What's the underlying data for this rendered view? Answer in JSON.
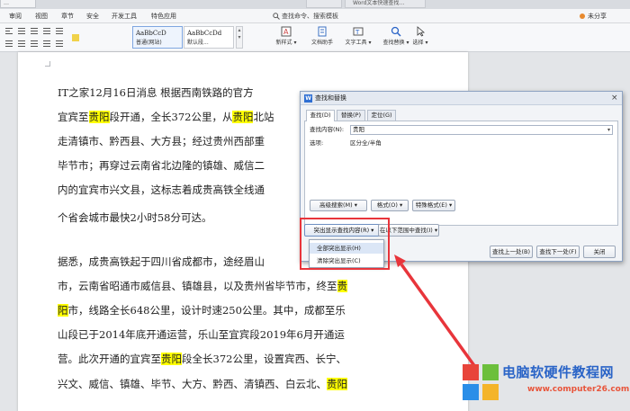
{
  "window": {
    "tab_left_fragment": "…",
    "app_tab_1": "",
    "app_tab_2": "Word文本快速查找…",
    "share": "未分享"
  },
  "menubar": {
    "items": [
      "审阅",
      "视图",
      "章节",
      "安全",
      "开发工具",
      "特色应用"
    ],
    "search": "查找命令、搜索模板"
  },
  "ribbon": {
    "styles": [
      {
        "sample": "AaBbCcD",
        "name": "普通(网站)"
      },
      {
        "sample": "AaBbCcDd",
        "name": "默认段..."
      }
    ],
    "tools": [
      {
        "label": "新样式 ▾",
        "icon": "new-style-icon"
      },
      {
        "label": "文档助手",
        "icon": "doc-helper-icon"
      },
      {
        "label": "文字工具 ▾",
        "icon": "text-tools-icon"
      },
      {
        "label": "查找替换 ▾",
        "icon": "find-replace-icon"
      },
      {
        "label": "选择 ▾",
        "icon": "select-icon"
      }
    ]
  },
  "document": {
    "lines": [
      [
        {
          "t": "IT之家12月16日消息 根据西南铁路的官方"
        }
      ],
      [
        {
          "t": "宜宾至"
        },
        {
          "t": "贵阳",
          "hl": true
        },
        {
          "t": "段开通，全长372公里，从"
        },
        {
          "t": "贵阳",
          "hl": true
        },
        {
          "t": "北站"
        }
      ],
      [
        {
          "t": "走清镇市、黔西县、大方县；经过贵州西部重"
        }
      ],
      [
        {
          "t": "毕节市；再穿过云南省北边隆的镇雄、威信二"
        }
      ],
      [
        {
          "t": "内的宜宾市兴文县，这标志着成贵高铁全线通"
        }
      ],
      [
        {
          "t": "个省会城市最快2小时58分可达。"
        }
      ],
      [
        {
          "t": "据悉，成贵高铁起于四川省成都市，途经眉山"
        }
      ],
      [
        {
          "t": "市，云南省昭通市威信县、镇雄县，以及贵州省毕节市，终至"
        },
        {
          "t": "贵",
          "hl": true
        }
      ],
      [
        {
          "t": "阳",
          "hl": true
        },
        {
          "t": "市，线路全长648公里，设计时速250公里。其中，成都至乐"
        }
      ],
      [
        {
          "t": "山段已于2014年底开通运营，乐山至宜宾段2019年6月开通运"
        }
      ],
      [
        {
          "t": "营。此次开通的宜宾至"
        },
        {
          "t": "贵阳",
          "hl": true
        },
        {
          "t": "段全长372公里，设置宾西、长宁、"
        }
      ],
      [
        {
          "t": "兴文、威信、镇雄、毕节、大方、黔西、清镇西、白云北、"
        },
        {
          "t": "贵阳",
          "hl": true
        }
      ]
    ]
  },
  "dialog": {
    "title": "查找和替换",
    "tabs": [
      "查找(D)",
      "替换(P)",
      "定位(G)"
    ],
    "find_label": "查找内容(N):",
    "find_value": "贵阳",
    "options_label": "选项:",
    "options_value": "区分全/半角",
    "buttons": {
      "advanced": "高级搜索(M) ▾",
      "format": "格式(O) ▾",
      "special": "特殊格式(E) ▾",
      "highlight": "突出显示查找内容(R) ▾",
      "range": "在以下范围中查找(I) ▾",
      "prev": "查找上一处(B)",
      "next": "查找下一处(F)",
      "close": "关闭"
    }
  },
  "dropdown": {
    "items": [
      "全部突出显示(H)",
      "清除突出显示(C)"
    ]
  },
  "watermark": {
    "title": "电脑软硬件教程网",
    "url": "www.computer26.com"
  },
  "colors": {
    "highlight": "#ffff00",
    "annotation": "#e8353b",
    "accent": "#2a64c7"
  }
}
